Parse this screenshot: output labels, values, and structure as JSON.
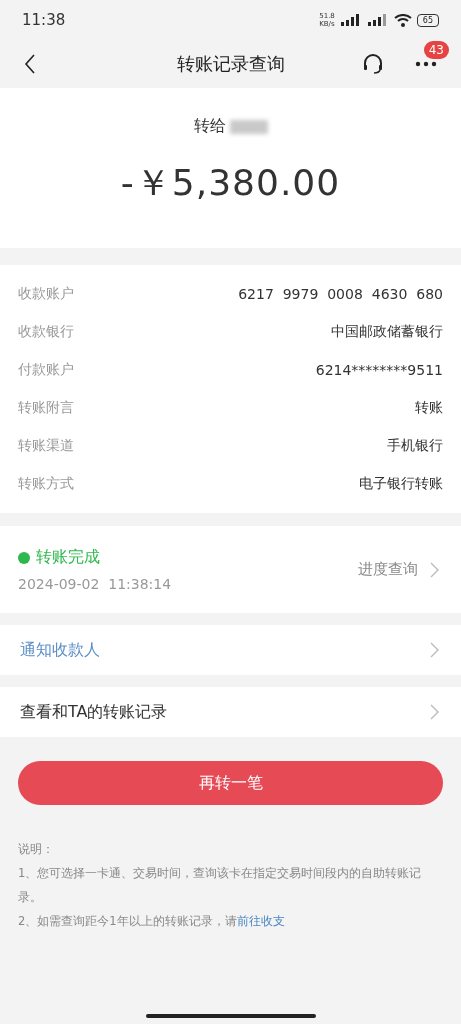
{
  "status_bar": {
    "time": "11:38",
    "speed": "51.8",
    "speed_unit": "KB/s",
    "battery": "65"
  },
  "header": {
    "title": "转账记录查询",
    "badge": "43"
  },
  "summary": {
    "recipient_prefix": "转给",
    "amount": "-￥5,380.00"
  },
  "details": [
    {
      "label": "收款账户",
      "value": "6217  9979  0008  4630  680"
    },
    {
      "label": "收款银行",
      "value": "中国邮政储蓄银行"
    },
    {
      "label": "付款账户",
      "value": "6214********9511"
    },
    {
      "label": "转账附言",
      "value": "转账"
    },
    {
      "label": "转账渠道",
      "value": "手机银行"
    },
    {
      "label": "转账方式",
      "value": "电子银行转账"
    }
  ],
  "status": {
    "label": "转账完成",
    "color": "#2db84d",
    "time": "2024-09-02  11:38:14",
    "action": "进度查询"
  },
  "links": [
    {
      "label": "通知收款人",
      "kind": "accent"
    },
    {
      "label": "查看和TA的转账记录",
      "kind": "plain"
    }
  ],
  "primary_button": "再转一笔",
  "notes": {
    "title": "说明：",
    "items": [
      {
        "text": "1、您可选择一卡通、交易时间，查询该卡在指定交易时间段内的自助转账记录。"
      },
      {
        "text": "2、如需查询距今1年以上的转账记录，请",
        "link": "前往收支"
      }
    ]
  }
}
